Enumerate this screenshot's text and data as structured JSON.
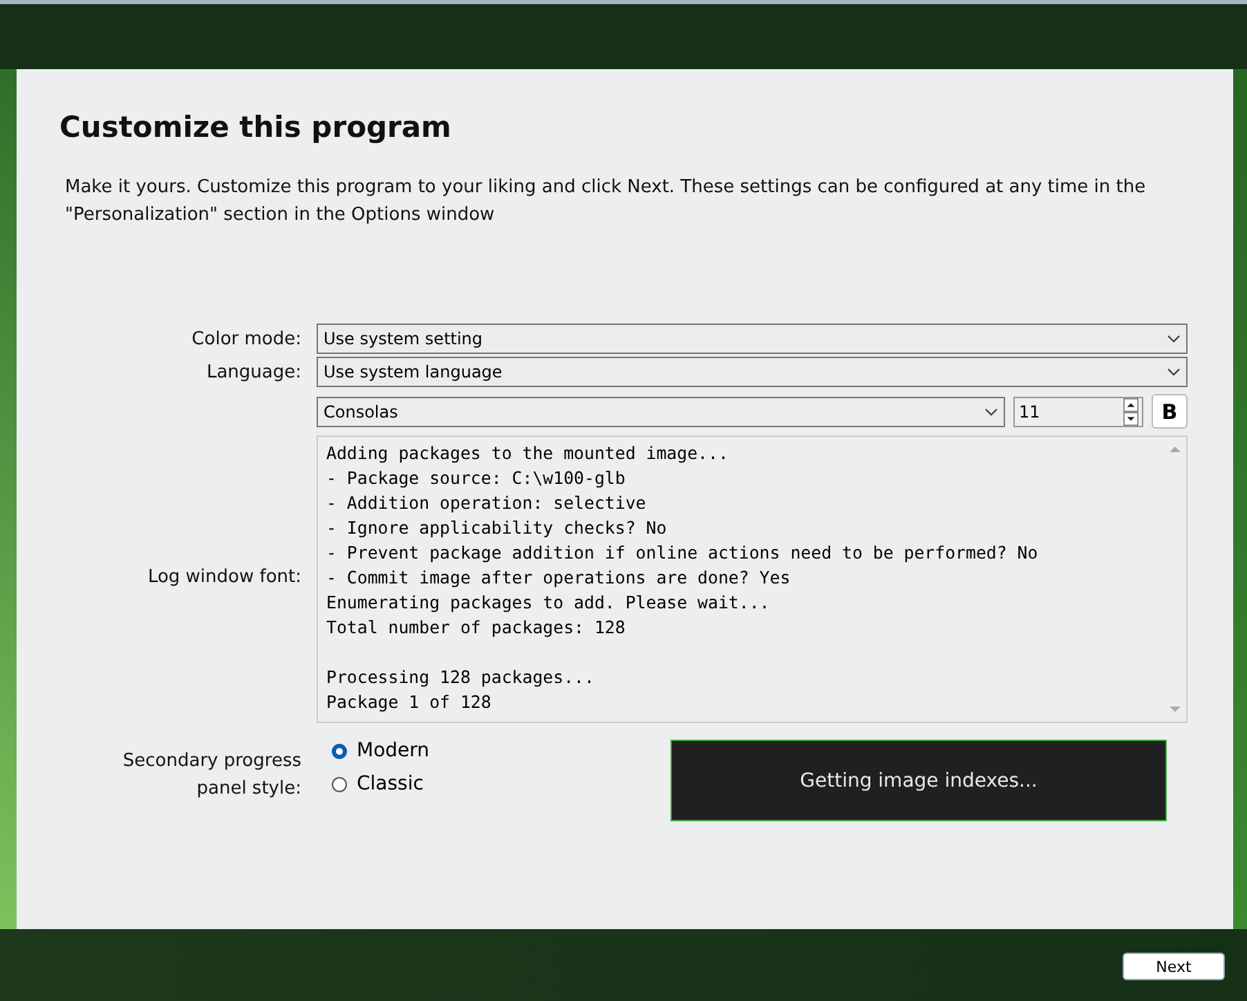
{
  "title": "Customize this program",
  "description": "Make it yours. Customize this program to your liking and click Next. These settings can be configured at any time in the \"Personalization\" section in the Options window",
  "color_mode": {
    "label": "Color mode:",
    "value": "Use system setting"
  },
  "language": {
    "label": "Language:",
    "value": "Use system language"
  },
  "log_font": {
    "label": "Log window font:",
    "font": "Consolas",
    "size": "11",
    "bold_button": "B",
    "preview_blocks": [
      [
        "Adding packages to the mounted image...",
        "- Package source: C:\\w100-glb",
        "- Addition operation: selective",
        "- Ignore applicability checks? No",
        "- Prevent package addition if online actions need to be performed? No",
        "- Commit image after operations are done? Yes",
        "Enumerating packages to add. Please wait...",
        "Total number of packages: 128"
      ],
      [
        "Processing 128 packages...",
        "Package 1 of 128"
      ]
    ]
  },
  "progress_style": {
    "label": "Secondary progress panel style:",
    "options": [
      {
        "label": "Modern",
        "selected": true
      },
      {
        "label": "Classic",
        "selected": false
      }
    ],
    "preview_text": "Getting image indexes..."
  },
  "buttons": [
    {
      "label": "Next"
    }
  ]
}
